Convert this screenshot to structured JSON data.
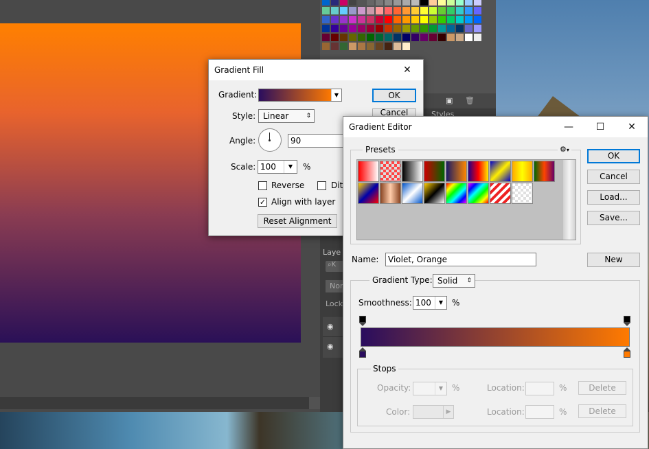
{
  "background": {
    "layers_tab": "Laye",
    "layers_search": "K",
    "layers_mode": "Nor",
    "layers_lock": "Lock",
    "styles_tab": "Styles",
    "swatch_colors": [
      [
        "#0066cc",
        "#2a2a7a",
        "#cc0066",
        "#444",
        "#555",
        "#666",
        "#777",
        "#888",
        "#999",
        "#aaa",
        "#bbb",
        "#000",
        "#ffcc99",
        "#ffff99",
        "#ccff99",
        "#99ffcc",
        "#99ccff",
        "#ccccff"
      ],
      [
        "#66cc99",
        "#66cccc",
        "#66ccff",
        "#9999cc",
        "#cc99cc",
        "#cc99aa",
        "#ff9999",
        "#ff6666",
        "#ff6633",
        "#ff9933",
        "#ffcc33",
        "#ffff33",
        "#ccff33",
        "#66cc33",
        "#33cc66",
        "#33cccc",
        "#3399ff",
        "#6666ff"
      ],
      [
        "#3366cc",
        "#6633cc",
        "#9933cc",
        "#cc33cc",
        "#cc3399",
        "#cc3366",
        "#cc0033",
        "#ff0000",
        "#ff6600",
        "#ff9900",
        "#ffcc00",
        "#ffff00",
        "#99cc00",
        "#33cc00",
        "#00cc66",
        "#00cccc",
        "#0099ff",
        "#0066ff"
      ],
      [
        "#003399",
        "#330099",
        "#660099",
        "#990099",
        "#990066",
        "#990033",
        "#990000",
        "#cc3300",
        "#996600",
        "#999900",
        "#669900",
        "#339900",
        "#009933",
        "#009999",
        "#006699",
        "#003366",
        "#6666cc",
        "#9999ff"
      ],
      [
        "#660033",
        "#660000",
        "#663300",
        "#666600",
        "#336600",
        "#006600",
        "#006633",
        "#006666",
        "#003366",
        "#000066",
        "#330066",
        "#660066",
        "#660033",
        "#330000",
        "#cc9966",
        "#ccaa88",
        "#ffffff",
        "#eeeeee"
      ],
      [
        "#996633",
        "#663333",
        "#336633",
        "#cc9966",
        "#aa7744",
        "#886633",
        "#664422",
        "#442211",
        "#ddbb99",
        "#ffeecc"
      ]
    ]
  },
  "gradient_fill": {
    "title": "Gradient Fill",
    "gradient_label": "Gradient:",
    "gradient_from": "#2a0d5e",
    "gradient_to": "#ff7a00",
    "ok": "OK",
    "cancel": "Cancel",
    "style_label": "Style:",
    "style_value": "Linear",
    "angle_label": "Angle:",
    "angle_value": "90",
    "scale_label": "Scale:",
    "scale_value": "100",
    "percent": "%",
    "reverse_label": "Reverse",
    "reverse_checked": false,
    "dither_label": "Dith",
    "dither_checked": false,
    "align_label": "Align with layer",
    "align_checked": true,
    "reset_label": "Reset Alignment"
  },
  "gradient_editor": {
    "title": "Gradient Editor",
    "presets_label": "Presets",
    "gear": "⚙",
    "ok": "OK",
    "cancel": "Cancel",
    "load": "Load...",
    "save": "Save...",
    "name_label": "Name:",
    "name_value": "Violet, Orange",
    "new_label": "New",
    "type_label": "Gradient Type:",
    "type_value": "Solid",
    "smoothness_label": "Smoothness:",
    "smoothness_value": "100",
    "percent": "%",
    "stops_label": "Stops",
    "opacity_label": "Opacity:",
    "color_label": "Color:",
    "location_label": "Location:",
    "delete_label": "Delete",
    "start_color": "#2a0d5e",
    "end_color": "#ff7a00",
    "presets": [
      "linear-gradient(to right,#ff0000,#fff)",
      "repeating-conic-gradient(#ddd 0 25%,#ff4444 0 50%) 0 0/8px 8px",
      "linear-gradient(to right,#000,#fff)",
      "linear-gradient(to right,#cc0000,#006600)",
      "linear-gradient(to right,#1a1a66,#ff8800)",
      "linear-gradient(to right,#220088,#ff0000,#ffee00)",
      "linear-gradient(135deg,#0000cc,#ffee00,#0000cc)",
      "linear-gradient(to right,#ffaa00,#ffff00,#ffaa00)",
      "linear-gradient(to right,#006600,#ff4400,#660066)",
      "linear-gradient(135deg,#ffcc00,#0000aa,#ff0000)",
      "linear-gradient(to right,#884422,#ffccaa,#884422)",
      "linear-gradient(135deg,#0055cc,#ffffff,#0055cc)",
      "linear-gradient(135deg,#ffcc00,#000,#ffffff)",
      "linear-gradient(135deg,#ff0000,#ffff00,#00ff00,#00ffff,#0000ff,#ff00ff)",
      "linear-gradient(135deg,#ff00ff,#0000ff,#00ffff,#00ff00,#ffff00,#ff0000)",
      "repeating-linear-gradient(135deg,#ee2222 0 4px,#fff 4px 8px)",
      "repeating-conic-gradient(#e0e0e0 0 25%,#ffffff 0 50%) 0 0/8px 8px"
    ]
  }
}
